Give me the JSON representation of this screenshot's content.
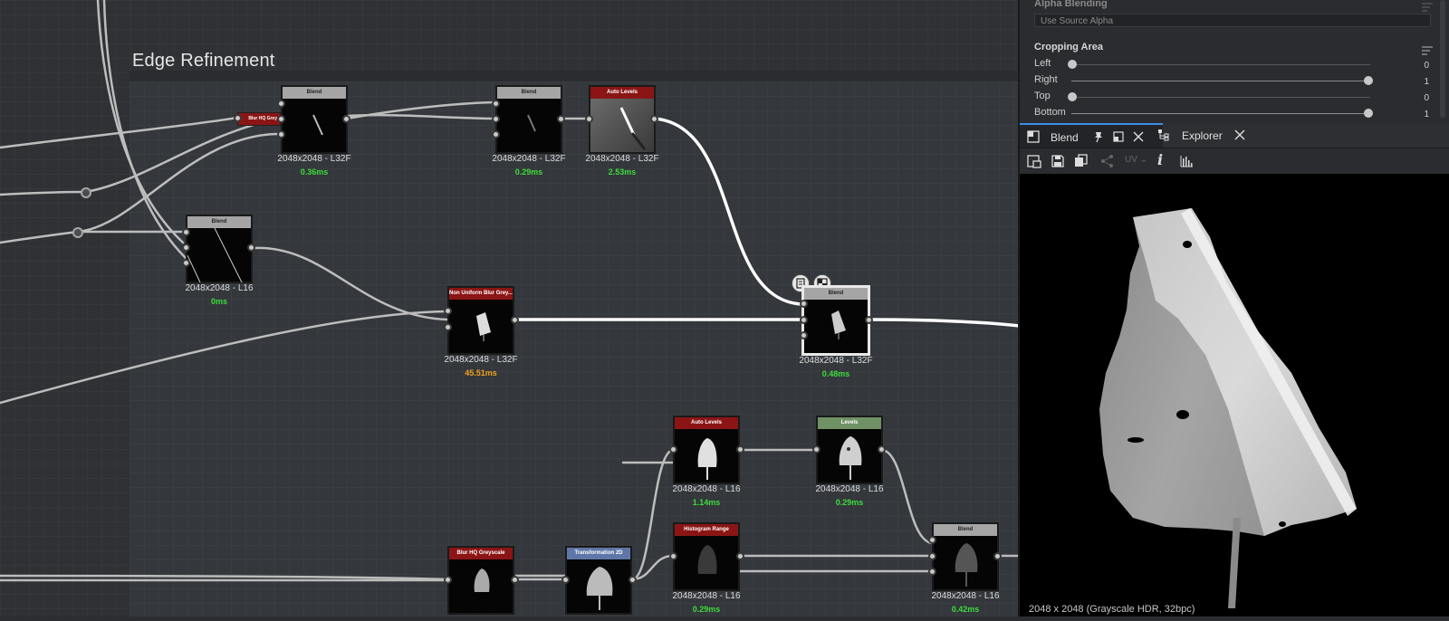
{
  "frame": {
    "title": "Edge Refinement"
  },
  "nodes": [
    {
      "id": "blend1",
      "title": "Blend",
      "resolution": "2048x2048 - L32F",
      "time": "0.36ms"
    },
    {
      "id": "blend2",
      "title": "Blend",
      "resolution": "2048x2048 - L32F",
      "time": "0.29ms"
    },
    {
      "id": "autolevels1",
      "title": "Auto Levels",
      "resolution": "2048x2048 - L32F",
      "time": "2.53ms"
    },
    {
      "id": "blur_partial",
      "title": "Blur HQ Grey"
    },
    {
      "id": "blend3",
      "title": "Blend",
      "resolution": "2048x2048 - L16",
      "time": "0ms"
    },
    {
      "id": "nonuniform",
      "title": "Non Uniform Blur Grey...",
      "resolution": "2048x2048 - L32F",
      "time": "45.51ms"
    },
    {
      "id": "blend_sel",
      "title": "Blend",
      "resolution": "2048x2048 - L32F",
      "time": "0.48ms"
    },
    {
      "id": "autolevels2",
      "title": "Auto Levels",
      "resolution": "2048x2048 - L16",
      "time": "1.14ms"
    },
    {
      "id": "levels",
      "title": "Levels",
      "resolution": "2048x2048 - L16",
      "time": "0.29ms"
    },
    {
      "id": "histrange",
      "title": "Histogram Range",
      "resolution": "2048x2048 - L16",
      "time": "0.29ms"
    },
    {
      "id": "blurhq",
      "title": "Blur HQ Greyscale"
    },
    {
      "id": "transform2d",
      "title": "Transformation 2D"
    },
    {
      "id": "blend_bottom",
      "title": "Blend",
      "resolution": "2048x2048 - L16",
      "time": "0.42ms"
    }
  ],
  "props": {
    "alpha_blending": {
      "title": "Alpha Blending",
      "value": "Use Source Alpha"
    },
    "cropping": {
      "title": "Cropping Area",
      "rows": [
        {
          "label": "Left",
          "value": "0",
          "level": 0
        },
        {
          "label": "Right",
          "value": "1",
          "level": 1
        },
        {
          "label": "Top",
          "value": "0",
          "level": 0
        },
        {
          "label": "Bottom",
          "value": "1",
          "level": 1
        }
      ]
    }
  },
  "tabs": [
    {
      "label": "Blend"
    },
    {
      "label": "Explorer"
    }
  ],
  "toolbar": {
    "uv_label": "UV"
  },
  "viewer": {
    "status": "2048 x 2048 (Grayscale HDR, 32bpc)"
  },
  "colors": {
    "time_ok": "#3ddc3d",
    "time_slow": "#f0a020",
    "header_red": "#8b1515",
    "header_gray": "#a5a5a5",
    "header_green": "#6f9165",
    "header_blue": "#5f77a8",
    "accent": "#3a8ee6"
  }
}
